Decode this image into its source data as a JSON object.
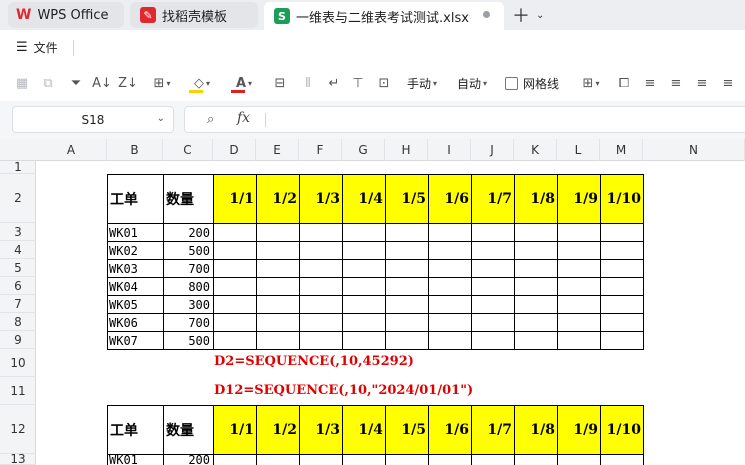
{
  "tabs": [
    {
      "label": "WPS Office",
      "icon": "wps-logo-icon"
    },
    {
      "label": "找稻壳模板",
      "icon": "docer-icon"
    },
    {
      "label": "一维表与二维表考试测试.xlsx",
      "icon": "spreadsheet-icon",
      "icon_text": "S",
      "icon_color": "#1e9d5a"
    }
  ],
  "menu": {
    "file_label": "文件"
  },
  "toolbar": {
    "wrap_label": "手动",
    "auto_label": "自动",
    "gridlines_label": "网格线",
    "fill_color": "#f5d400",
    "font_color": "#e02020"
  },
  "formula_bar": {
    "name_box": "S18",
    "fx_symbol": "fx",
    "content": ""
  },
  "sheet": {
    "columns": [
      "A",
      "B",
      "C",
      "D",
      "E",
      "F",
      "G",
      "H",
      "I",
      "J",
      "K",
      "L",
      "M",
      "N"
    ],
    "rows": [
      "1",
      "2",
      "3",
      "4",
      "5",
      "6",
      "7",
      "8",
      "9",
      "10",
      "11",
      "12",
      "13"
    ],
    "table1": {
      "header": {
        "order": "工单",
        "qty": "数量"
      },
      "dates": [
        "1/1",
        "1/2",
        "1/3",
        "1/4",
        "1/5",
        "1/6",
        "1/7",
        "1/8",
        "1/9",
        "1/10"
      ],
      "rows": [
        {
          "order": "WK01",
          "qty": "200"
        },
        {
          "order": "WK02",
          "qty": "500"
        },
        {
          "order": "WK03",
          "qty": "700"
        },
        {
          "order": "WK04",
          "qty": "800"
        },
        {
          "order": "WK05",
          "qty": "300"
        },
        {
          "order": "WK06",
          "qty": "700"
        },
        {
          "order": "WK07",
          "qty": "500"
        }
      ]
    },
    "formula1": "D2=SEQUENCE(,10,45292)",
    "formula2": "D12=SEQUENCE(,10,\"2024/01/01\")",
    "table2": {
      "header": {
        "order": "工单",
        "qty": "数量"
      },
      "dates": [
        "1/1",
        "1/2",
        "1/3",
        "1/4",
        "1/5",
        "1/6",
        "1/7",
        "1/8",
        "1/9",
        "1/10"
      ],
      "rows": [
        {
          "order": "WK01",
          "qty": "200"
        }
      ]
    },
    "header_fill": "#ffff00",
    "formula_color": "#e00000"
  }
}
